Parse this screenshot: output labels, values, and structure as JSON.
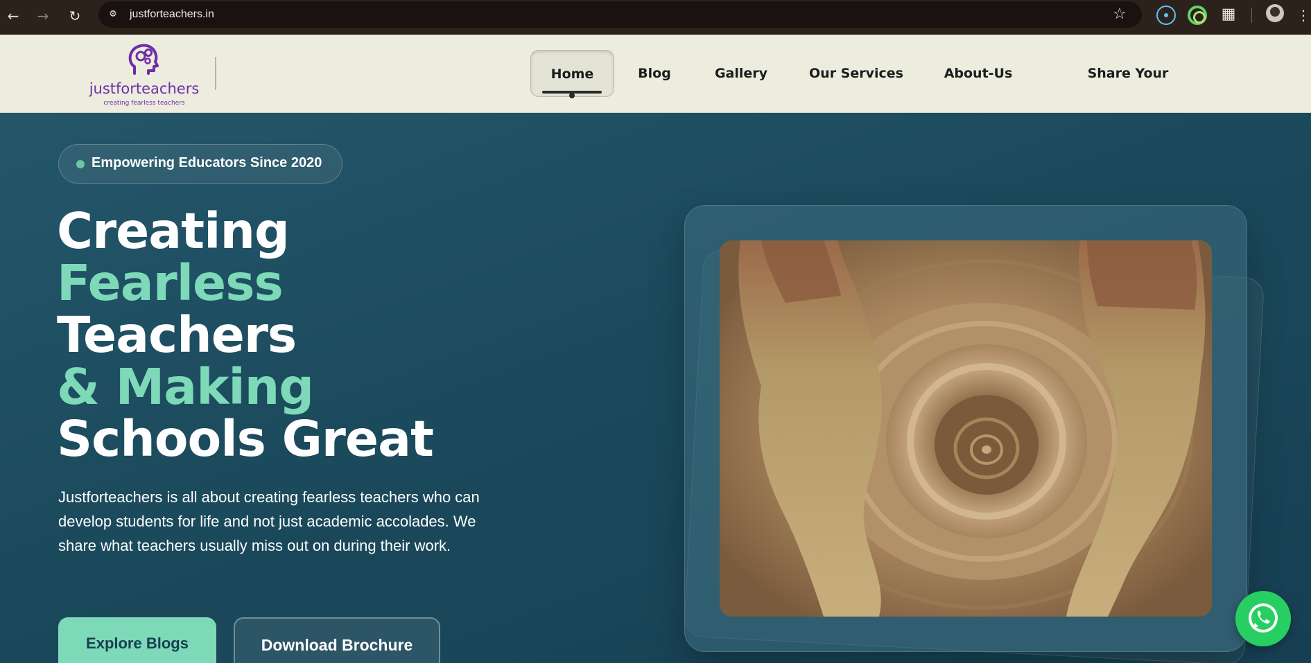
{
  "browser": {
    "url": "justforteachers.in"
  },
  "logo": {
    "wordmark": "justforteachers",
    "tagline": "creating fearless teachers"
  },
  "nav": {
    "items": [
      "Home",
      "Blog",
      "Gallery",
      "Our Services",
      "About-Us",
      "Share Your Thoughts"
    ],
    "active": "Home"
  },
  "hero": {
    "badge": "Empowering Educators Since 2020",
    "headline": [
      "Creating",
      "Fearless",
      "Teachers",
      "& Making",
      "Schools Great"
    ],
    "description": "Justforteachers is all about creating fearless teachers who can develop students for life and not just academic accolades. We share what teachers usually miss out on during their work.",
    "primary_button": "Explore Blogs",
    "secondary_button": "Download Brochure"
  },
  "colors": {
    "accent_green": "#7dd9b8",
    "hero_bg": "#1b4a5c",
    "header_bg": "#ececdf",
    "brand_purple": "#6f2ea8",
    "whatsapp": "#27cf62"
  },
  "icons": {
    "whatsapp": "whatsapp-icon",
    "chat": "whatsapp-chat-button"
  }
}
